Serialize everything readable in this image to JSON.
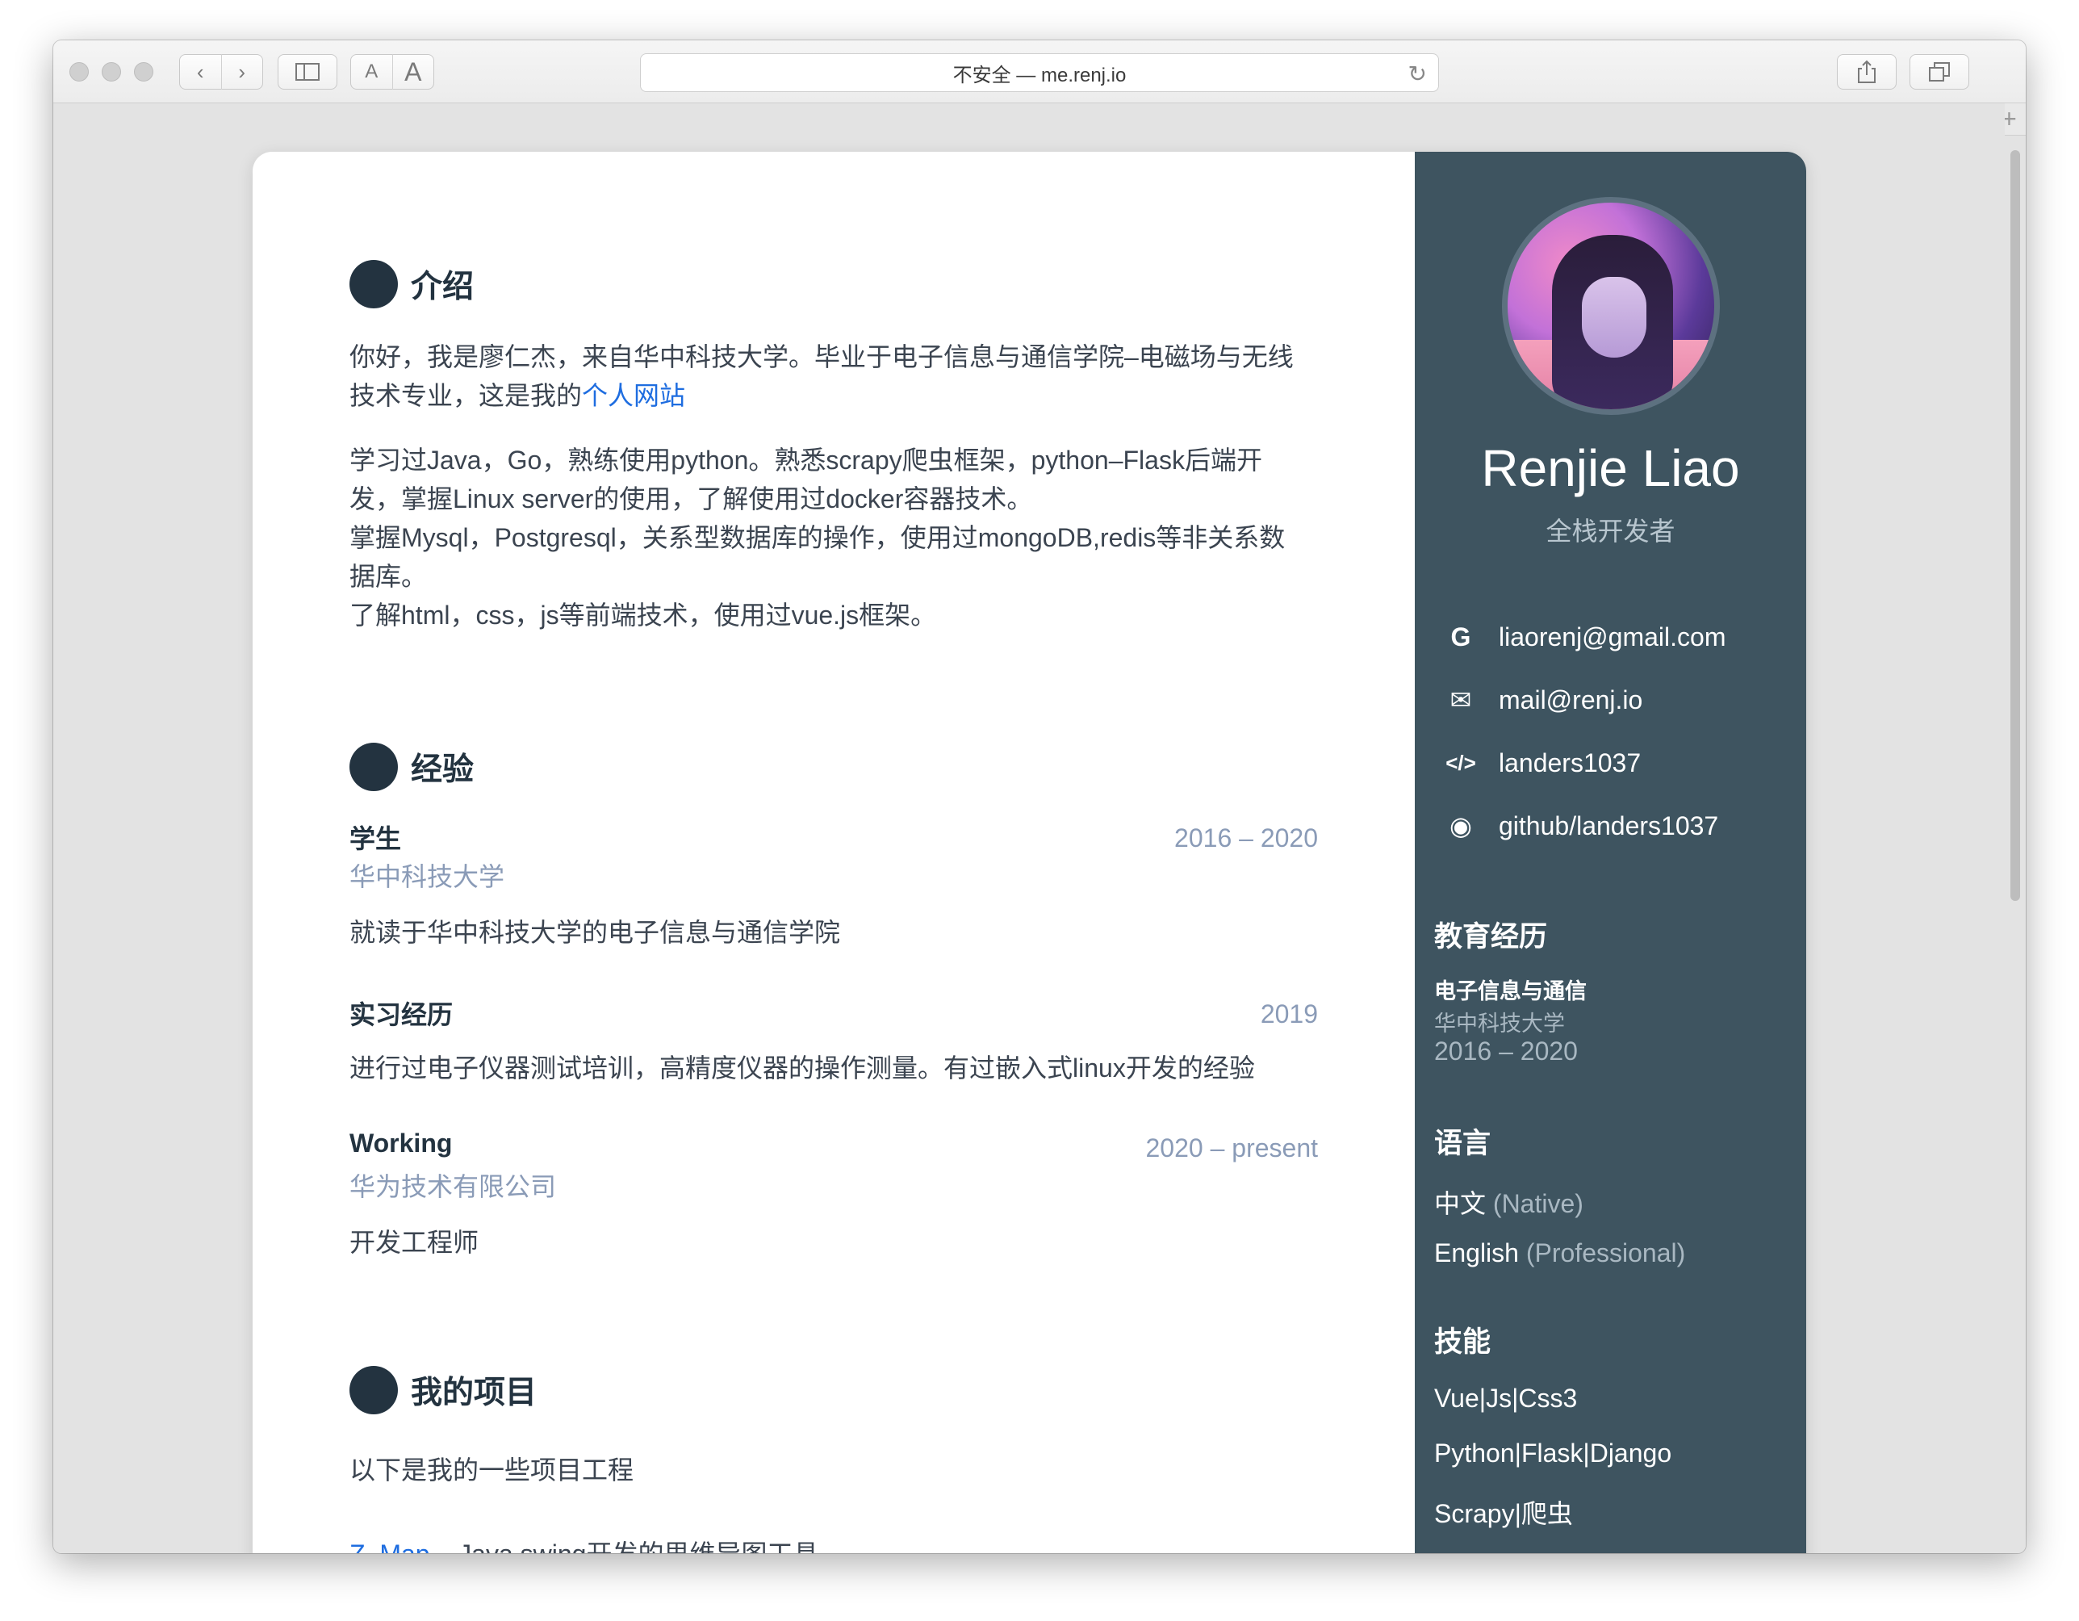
{
  "browser": {
    "address": "不安全 — me.renj.io",
    "reader_small": "A",
    "reader_large": "A",
    "new_tab": "+"
  },
  "intro": {
    "title": "介绍",
    "p1_text": "你好，我是廖仁杰，来自华中科技大学。毕业于电子信息与通信学院–电磁场与无线技术专业，这是我的",
    "p1_link": "个人网站",
    "p2": "学习过Java，Go，熟练使用python。熟悉scrapy爬虫框架，python–Flask后端开发，掌握Linux server的使用，了解使用过docker容器技术。",
    "p3": "掌握Mysql，Postgresql，关系型数据库的操作，使用过mongoDB,redis等非关系数据库。",
    "p4": "了解html，css，js等前端技术，使用过vue.js框架。"
  },
  "experience": {
    "title": "经验",
    "items": [
      {
        "title": "学生",
        "org": "华中科技大学",
        "date": "2016 – 2020",
        "desc": "就读于华中科技大学的电子信息与通信学院"
      },
      {
        "title": "实习经历",
        "org": "",
        "date": "2019",
        "desc": "进行过电子仪器测试培训，高精度仪器的操作测量。有过嵌入式linux开发的经验"
      },
      {
        "title": "Working",
        "org": "华为技术有限公司",
        "date": "2020 – present",
        "desc": "开发工程师"
      }
    ]
  },
  "projects": {
    "title": "我的项目",
    "intro": "以下是我的一些项目工程",
    "first_link": "Z–Map",
    "first_desc": " – Java swing开发的思维导图工具"
  },
  "sidebar": {
    "name": "Renjie Liao",
    "role": "全栈开发者",
    "contacts": [
      {
        "icon": "google-icon",
        "glyph": "G",
        "text": "liaorenj@gmail.com"
      },
      {
        "icon": "envelope-icon",
        "glyph": "✉",
        "text": "mail@renj.io"
      },
      {
        "icon": "code-icon",
        "glyph": "</>",
        "text": "landers1037"
      },
      {
        "icon": "github-icon",
        "glyph": "◉",
        "text": "github/landers1037"
      }
    ],
    "education": {
      "title": "教育经历",
      "degree": "电子信息与通信",
      "school": "华中科技大学",
      "years": "2016 – 2020"
    },
    "languages": {
      "title": "语言",
      "items": [
        {
          "name": "中文",
          "level": "(Native)"
        },
        {
          "name": "English",
          "level": "(Professional)"
        }
      ]
    },
    "skills": {
      "title": "技能",
      "items": [
        "Vue|Js|Css3",
        "Python|Flask|Django",
        "Scrapy|爬虫"
      ]
    }
  }
}
